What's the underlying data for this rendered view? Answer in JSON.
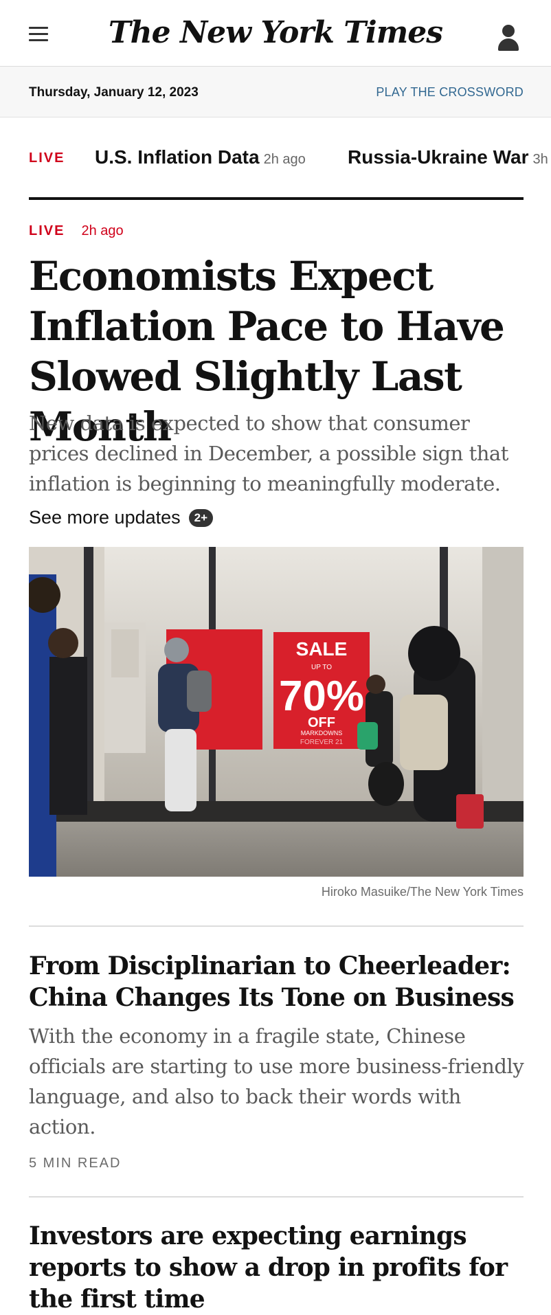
{
  "header": {
    "logo": "The New York Times",
    "date": "Thursday, January 12, 2023",
    "crossword_link": "PLAY THE CROSSWORD"
  },
  "ticker": {
    "live_label": "LIVE",
    "items": [
      {
        "title": "U.S. Inflation Data",
        "ago": "2h ago"
      },
      {
        "title": "Russia-Ukraine War",
        "ago": "3h"
      }
    ]
  },
  "lead": {
    "live_label": "LIVE",
    "ago": "2h ago",
    "headline": "Economists Expect Inflation Pace to Have Slowed Slightly Last Month",
    "summary": "New data is expected to show that consumer prices declined in December, a possible sign that inflation is beginning to meaningfully moderate.",
    "more_updates": "See more updates",
    "updates_badge": "2+",
    "photo_sign_sale": "SALE",
    "photo_sign_upto": "UP TO",
    "photo_sign_percent": "70%",
    "photo_sign_off": "OFF",
    "photo_sign_markdowns": "MARKDOWNS",
    "photo_sign_brand": "FOREVER 21",
    "photo_credit": "Hiroko Masuike/The New York Times"
  },
  "stories": [
    {
      "headline": "From Disciplinarian to Cheerleader: China Changes Its Tone on Business",
      "summary": "With the economy in a fragile state, Chinese officials are starting to use more business-friendly language, and also to back their words with action.",
      "read_time": "5 MIN READ"
    },
    {
      "headline": "Investors are expecting earnings reports to show a drop in profits for the first time"
    }
  ]
}
